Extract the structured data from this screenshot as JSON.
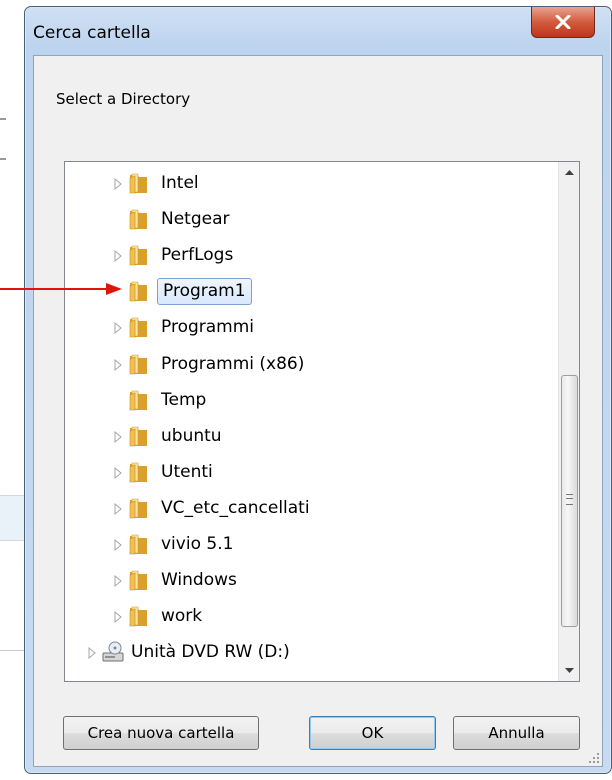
{
  "dialog": {
    "title": "Cerca cartella",
    "prompt": "Select a Directory",
    "tree_items": [
      {
        "label": "Intel",
        "has_children": true,
        "icon": "folder-icon",
        "selected": false
      },
      {
        "label": "Netgear",
        "has_children": false,
        "icon": "folder-icon",
        "selected": false
      },
      {
        "label": "PerfLogs",
        "has_children": true,
        "icon": "folder-icon",
        "selected": false
      },
      {
        "label": "Program1",
        "has_children": false,
        "icon": "folder-icon",
        "selected": true
      },
      {
        "label": "Programmi",
        "has_children": true,
        "icon": "folder-icon",
        "selected": false
      },
      {
        "label": "Programmi (x86)",
        "has_children": true,
        "icon": "folder-icon",
        "selected": false
      },
      {
        "label": "Temp",
        "has_children": false,
        "icon": "folder-icon",
        "selected": false
      },
      {
        "label": "ubuntu",
        "has_children": true,
        "icon": "folder-icon",
        "selected": false
      },
      {
        "label": "Utenti",
        "has_children": true,
        "icon": "folder-icon",
        "selected": false
      },
      {
        "label": "VC_etc_cancellati",
        "has_children": true,
        "icon": "folder-icon",
        "selected": false
      },
      {
        "label": "vivio 5.1",
        "has_children": true,
        "icon": "folder-icon",
        "selected": false
      },
      {
        "label": "Windows",
        "has_children": true,
        "icon": "folder-icon",
        "selected": false
      },
      {
        "label": "work",
        "has_children": true,
        "icon": "folder-icon",
        "selected": false
      },
      {
        "label": "Unità DVD RW (D:)",
        "has_children": true,
        "icon": "dvd-drive-icon",
        "selected": false
      }
    ],
    "buttons": {
      "new_folder": "Crea nuova cartella",
      "ok": "OK",
      "cancel": "Annulla"
    }
  },
  "annotation": {
    "arrow_color": "#e0140e"
  },
  "colors": {
    "title_bar": "#c6dbf1",
    "close_button": "#c7442a",
    "selection_border": "#7da2ce",
    "folder": "#e8b84a"
  }
}
